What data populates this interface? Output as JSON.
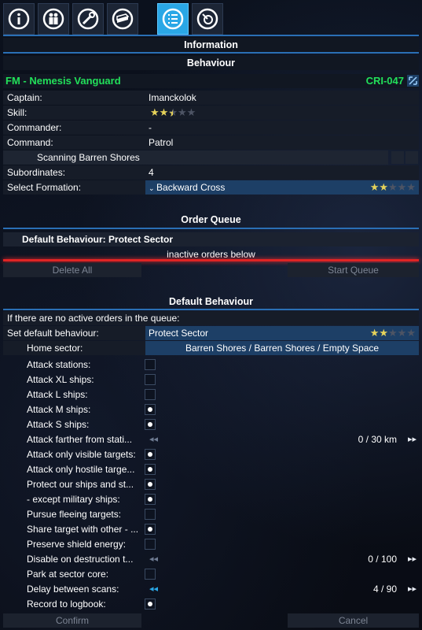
{
  "tabs": [
    {
      "icon": "info-icon",
      "active": false
    },
    {
      "icon": "crew-icon",
      "active": false
    },
    {
      "icon": "wrench-icon",
      "active": false
    },
    {
      "icon": "cargo-icon",
      "active": false
    },
    {
      "icon": "list-icon",
      "active": true
    },
    {
      "icon": "sensor-icon",
      "active": false
    }
  ],
  "headers": {
    "information": "Information",
    "behaviour": "Behaviour",
    "order_queue": "Order Queue",
    "default_behaviour": "Default Behaviour"
  },
  "ship": {
    "name": "FM - Nemesis Vanguard",
    "code": "CRI-047"
  },
  "info_rows": {
    "captain_label": "Captain:",
    "captain_value": "Imanckolok",
    "skill_label": "Skill:",
    "skill_stars": 2.5,
    "commander_label": "Commander:",
    "commander_value": "-",
    "command_label": "Command:",
    "command_value": "Patrol",
    "scanning_label": "Scanning Barren Shores",
    "subordinates_label": "Subordinates:",
    "subordinates_value": "4",
    "formation_label": "Select Formation:",
    "formation_value": "Backward Cross",
    "formation_stars": 2
  },
  "order_queue": {
    "default_text": "Default Behaviour: Protect Sector",
    "inactive_text": "inactive orders below",
    "delete_all": "Delete All",
    "start_queue": "Start Queue"
  },
  "default_behaviour": {
    "no_orders_text": "If there are no active orders in the queue:",
    "set_label": "Set default behaviour:",
    "set_value": "Protect Sector",
    "set_stars": 2,
    "home_label": "Home sector:",
    "home_value": "Barren Shores / Barren Shores / Empty Space",
    "options": [
      {
        "label": "Attack stations:",
        "type": "checkbox",
        "checked": false
      },
      {
        "label": "Attack XL ships:",
        "type": "checkbox",
        "checked": false
      },
      {
        "label": "Attack L ships:",
        "type": "checkbox",
        "checked": false
      },
      {
        "label": "Attack M ships:",
        "type": "checkbox",
        "checked": true
      },
      {
        "label": "Attack S ships:",
        "type": "checkbox",
        "checked": true
      },
      {
        "label": "Attack farther from stati...",
        "type": "slider",
        "value": "0 / 30 km"
      },
      {
        "label": "Attack only visible targets:",
        "type": "checkbox",
        "checked": true
      },
      {
        "label": "Attack only hostile targe...",
        "type": "checkbox",
        "checked": true
      },
      {
        "label": "Protect our ships and st...",
        "type": "checkbox",
        "checked": true
      },
      {
        "label": " - except military ships:",
        "type": "checkbox",
        "checked": true
      },
      {
        "label": "Pursue fleeing targets:",
        "type": "checkbox",
        "checked": false
      },
      {
        "label": "Share target with other - ...",
        "type": "checkbox",
        "checked": true
      },
      {
        "label": "Preserve shield energy:",
        "type": "checkbox",
        "checked": false
      },
      {
        "label": "Disable on destruction t...",
        "type": "slider",
        "value": "0 / 100"
      },
      {
        "label": "Park at sector core:",
        "type": "checkbox",
        "checked": false
      },
      {
        "label": "Delay between scans:",
        "type": "slider",
        "value": "4 / 90",
        "active": true
      },
      {
        "label": "Record to logbook:",
        "type": "checkbox",
        "checked": true
      }
    ],
    "confirm": "Confirm",
    "cancel": "Cancel"
  },
  "colors": {
    "accent": "#2aa7e6",
    "ship_green": "#22e05a",
    "alert_red": "#e02424",
    "star_gold": "#e6d35a"
  }
}
